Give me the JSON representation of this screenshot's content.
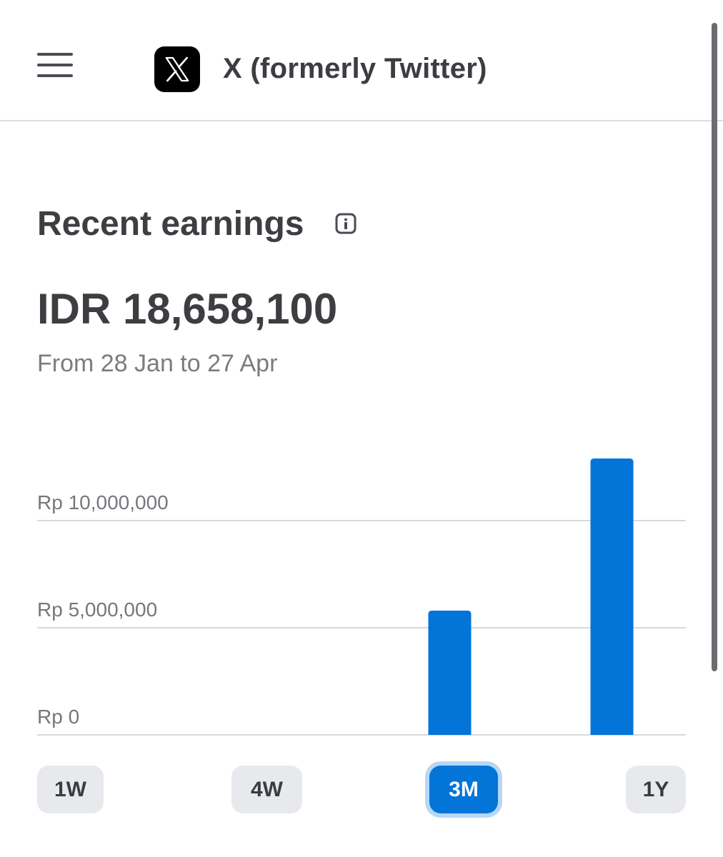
{
  "header": {
    "app_title": "X (formerly Twitter)"
  },
  "earnings": {
    "title": "Recent earnings",
    "amount": "IDR 18,658,100",
    "date_range": "From 28 Jan to 27 Apr"
  },
  "chart_data": {
    "type": "bar",
    "categories": [
      "",
      "",
      "",
      ""
    ],
    "values": [
      0,
      0,
      5800000,
      12900000
    ],
    "yticks": [
      {
        "value": 0,
        "label": "Rp 0"
      },
      {
        "value": 5000000,
        "label": "Rp 5,000,000"
      },
      {
        "value": 10000000,
        "label": "Rp 10,000,000"
      }
    ],
    "ylim": [
      0,
      13000000
    ],
    "grid": true,
    "bar_color": "#0374d8"
  },
  "ranges": [
    {
      "label": "1W",
      "active": false
    },
    {
      "label": "4W",
      "active": false
    },
    {
      "label": "3M",
      "active": true
    },
    {
      "label": "1Y",
      "active": false
    }
  ],
  "colors": {
    "accent": "#0374d8",
    "button_bg": "#e8e9ed",
    "text": "#3d3e42",
    "muted_text": "#7b7c82",
    "gridline": "#d8d9dd"
  },
  "icons": {
    "menu": "hamburger-menu-icon",
    "app": "x-logo-icon",
    "info": "info-icon"
  }
}
